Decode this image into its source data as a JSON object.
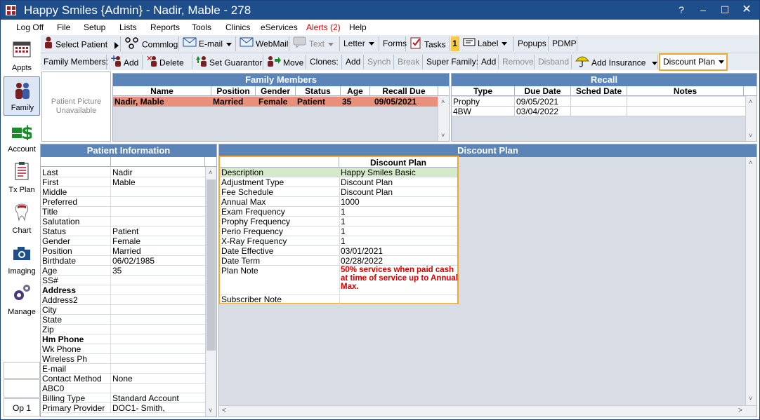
{
  "window": {
    "title": "Happy Smiles {Admin} - Nadir, Mable - 278",
    "help": "?"
  },
  "menu": [
    "Log Off",
    "File",
    "Setup",
    "Lists",
    "Reports",
    "Tools",
    "Clinics",
    "eServices",
    "Alerts (2)",
    "Help"
  ],
  "toolbar1": {
    "select_patient": "Select Patient",
    "commlog": "Commlog",
    "email": "E-mail",
    "webmail": "WebMail",
    "text": "Text",
    "letter": "Letter",
    "forms": "Forms",
    "tasks": "Tasks",
    "tasks_badge": "1",
    "label": "Label",
    "popups": "Popups",
    "pdmp": "PDMP"
  },
  "toolbar2": {
    "family_members": "Family Members:",
    "add": "Add",
    "delete": "Delete",
    "set_guarantor": "Set Guarantor",
    "move": "Move",
    "clones": "Clones:",
    "clones_add": "Add",
    "synch": "Synch",
    "break": "Break",
    "super_family": "Super Family:",
    "sf_add": "Add",
    "remove": "Remove",
    "disband": "Disband",
    "add_insurance": "Add Insurance",
    "discount_plan": "Discount Plan"
  },
  "sidebar": [
    "Appts",
    "Family",
    "Account",
    "Tx Plan",
    "Chart",
    "Imaging",
    "Manage"
  ],
  "sidebar_op": "Op 1",
  "picture": "Patient Picture Unavailable",
  "family": {
    "title": "Family Members",
    "columns": [
      "Name",
      "Position",
      "Gender",
      "Status",
      "Age",
      "Recall Due"
    ],
    "rows": [
      [
        "Nadir, Mable",
        "Married",
        "Female",
        "Patient",
        "35",
        "09/05/2021"
      ]
    ]
  },
  "recall": {
    "title": "Recall",
    "columns": [
      "Type",
      "Due Date",
      "Sched Date",
      "Notes"
    ],
    "rows": [
      [
        "Prophy",
        "09/05/2021",
        "",
        ""
      ],
      [
        "4BW",
        "03/04/2022",
        "",
        ""
      ]
    ]
  },
  "patient_info": {
    "title": "Patient Information",
    "rows": [
      [
        "Last",
        "Nadir"
      ],
      [
        "First",
        "Mable"
      ],
      [
        "Middle",
        ""
      ],
      [
        "Preferred",
        ""
      ],
      [
        "Title",
        ""
      ],
      [
        "Salutation",
        ""
      ],
      [
        "Status",
        "Patient"
      ],
      [
        "Gender",
        "Female"
      ],
      [
        "Position",
        "Married"
      ],
      [
        "Birthdate",
        "06/02/1985"
      ],
      [
        "Age",
        "35"
      ],
      [
        "SS#",
        ""
      ],
      [
        "Address",
        ""
      ],
      [
        "Address2",
        ""
      ],
      [
        "City",
        ""
      ],
      [
        "State",
        ""
      ],
      [
        "Zip",
        ""
      ],
      [
        "Hm Phone",
        ""
      ],
      [
        "Wk Phone",
        ""
      ],
      [
        "Wireless Ph",
        ""
      ],
      [
        "E-mail",
        ""
      ],
      [
        "Contact Method",
        "None"
      ],
      [
        "ABC0",
        ""
      ],
      [
        "Billing Type",
        "Standard Account"
      ],
      [
        "Primary Provider",
        "DOC1- Smith,"
      ]
    ]
  },
  "discount_plan": {
    "title": "Discount Plan",
    "column": "Discount Plan",
    "rows": [
      [
        "Description",
        "Happy Smiles Basic"
      ],
      [
        "Adjustment Type",
        "Discount Plan"
      ],
      [
        "Fee Schedule",
        "Discount Plan"
      ],
      [
        "Annual Max",
        "1000"
      ],
      [
        "Exam Frequency",
        "1"
      ],
      [
        "Prophy Frequency",
        "1"
      ],
      [
        "Perio Frequency",
        "1"
      ],
      [
        "X-Ray Frequency",
        "1"
      ],
      [
        "Date Effective",
        "03/01/2021"
      ],
      [
        "Date Term",
        "02/28/2022"
      ]
    ],
    "plan_note_label": "Plan Note",
    "plan_note": [
      "50% services when paid cash",
      "at time of service up to Annual",
      "Max."
    ],
    "subscriber_note_label": "Subscriber Note"
  },
  "colors": {
    "titlebar": "#1f4e8c",
    "panel_header": "#5b84b8",
    "selected_row": "#e8907a",
    "highlight": "#f0a830",
    "desc_row": "#d5eac8",
    "note": "#d40000"
  }
}
